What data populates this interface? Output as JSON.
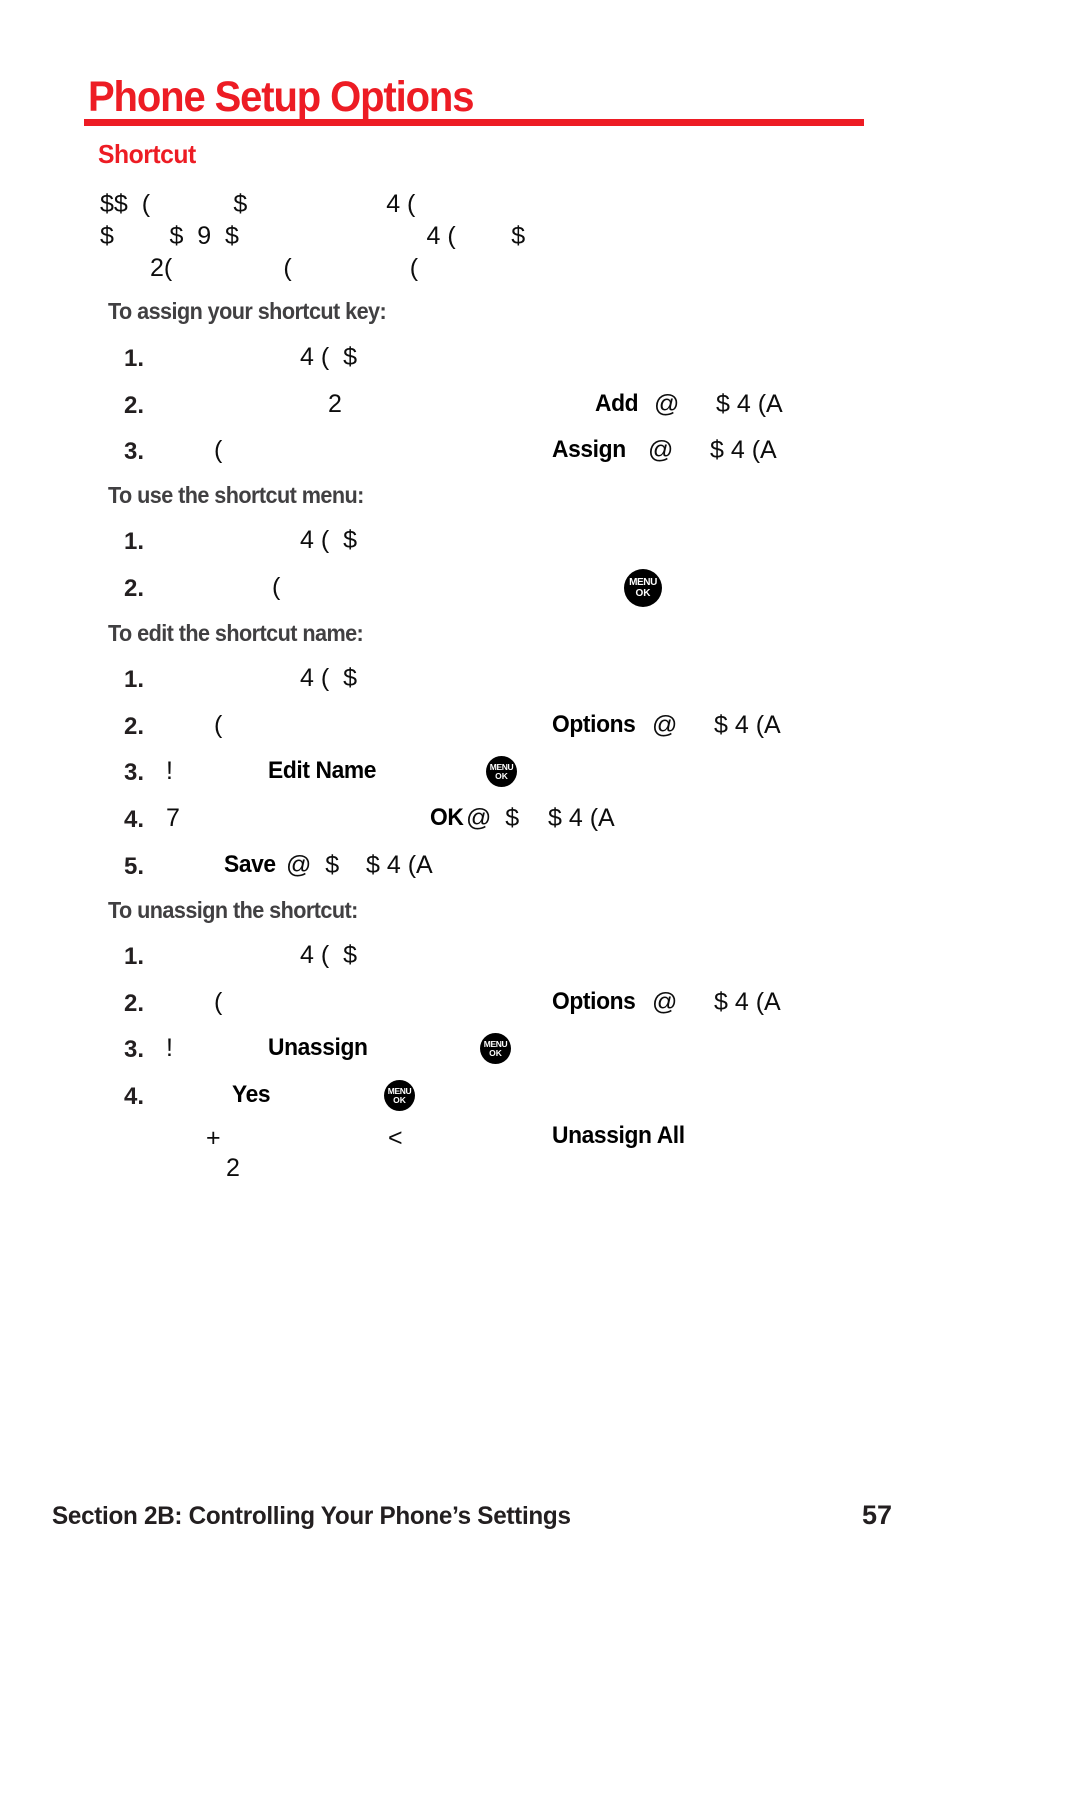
{
  "document": {
    "title": "Phone Setup Options",
    "section_heading": "Shortcut",
    "accent_color": "#ed1c24",
    "heading_color": "#414042",
    "body_color": "#0d0d0d"
  },
  "intro": {
    "line1": "$$  (            $                    4 (",
    "line2": "$        $  9  $                           4 (        $",
    "line3": "2(                (                 ("
  },
  "procedures": [
    {
      "heading": "To assign your shortcut key:",
      "steps": [
        {
          "number": "1.",
          "glyph_left": "4 (  $",
          "ui_label": "",
          "glyph_right": ""
        },
        {
          "number": "2.",
          "glyph_left": "2",
          "ui_label": "Add",
          "ui_suffix": "@",
          "glyph_right": "$ 4 (A"
        },
        {
          "number": "3.",
          "glyph_left": "(",
          "ui_label": "Assign",
          "ui_suffix": "@",
          "glyph_right": "$ 4 (A"
        }
      ]
    },
    {
      "heading": "To use the shortcut menu:",
      "steps": [
        {
          "number": "1.",
          "glyph_left": "4 (  $",
          "ui_label": "",
          "glyph_right": ""
        },
        {
          "number": "2.",
          "glyph_left": "(",
          "ui_label": "",
          "glyph_right": "",
          "icon": "menu-ok-key-icon"
        }
      ]
    },
    {
      "heading": "To edit the shortcut name:",
      "steps": [
        {
          "number": "1.",
          "glyph_left": "4 (  $",
          "ui_label": "",
          "glyph_right": ""
        },
        {
          "number": "2.",
          "glyph_left": "(",
          "ui_label": "Options",
          "ui_suffix": "@",
          "glyph_right": "$ 4 (A"
        },
        {
          "number": "3.",
          "glyph_left": "!",
          "ui_label": "Edit Name",
          "ui_suffix": "",
          "glyph_right": "",
          "icon": "menu-ok-key-icon"
        },
        {
          "number": "4.",
          "glyph_left": "7",
          "ui_label": "OK",
          "ui_suffix": "@  $",
          "glyph_right": "$ 4 (A"
        },
        {
          "number": "5.",
          "glyph_left": "",
          "ui_label": "Save",
          "ui_suffix": "@  $",
          "glyph_right": "$ 4 (A"
        }
      ]
    },
    {
      "heading": "To unassign the shortcut:",
      "steps": [
        {
          "number": "1.",
          "glyph_left": "4 (  $",
          "ui_label": "",
          "glyph_right": ""
        },
        {
          "number": "2.",
          "glyph_left": "(",
          "ui_label": "Options",
          "ui_suffix": "@",
          "glyph_right": "$ 4 (A"
        },
        {
          "number": "3.",
          "glyph_left": "!",
          "ui_label": "Unassign",
          "ui_suffix": "",
          "glyph_right": "",
          "icon": "menu-ok-key-icon"
        },
        {
          "number": "4.",
          "glyph_left": "",
          "ui_label": "Yes",
          "ui_suffix": "",
          "glyph_right": "",
          "icon": "menu-ok-key-icon"
        }
      ]
    }
  ],
  "note": {
    "glyph_left": "+",
    "glyph_mid": "<",
    "ui_label": "Unassign All",
    "glyph_next_line": "2"
  },
  "icons": {
    "menu_ok": {
      "top": "MENU",
      "bottom": "OK"
    }
  },
  "footer": {
    "section_label": "Section 2B: Controlling Your Phone’s Settings",
    "page_number": "57"
  }
}
